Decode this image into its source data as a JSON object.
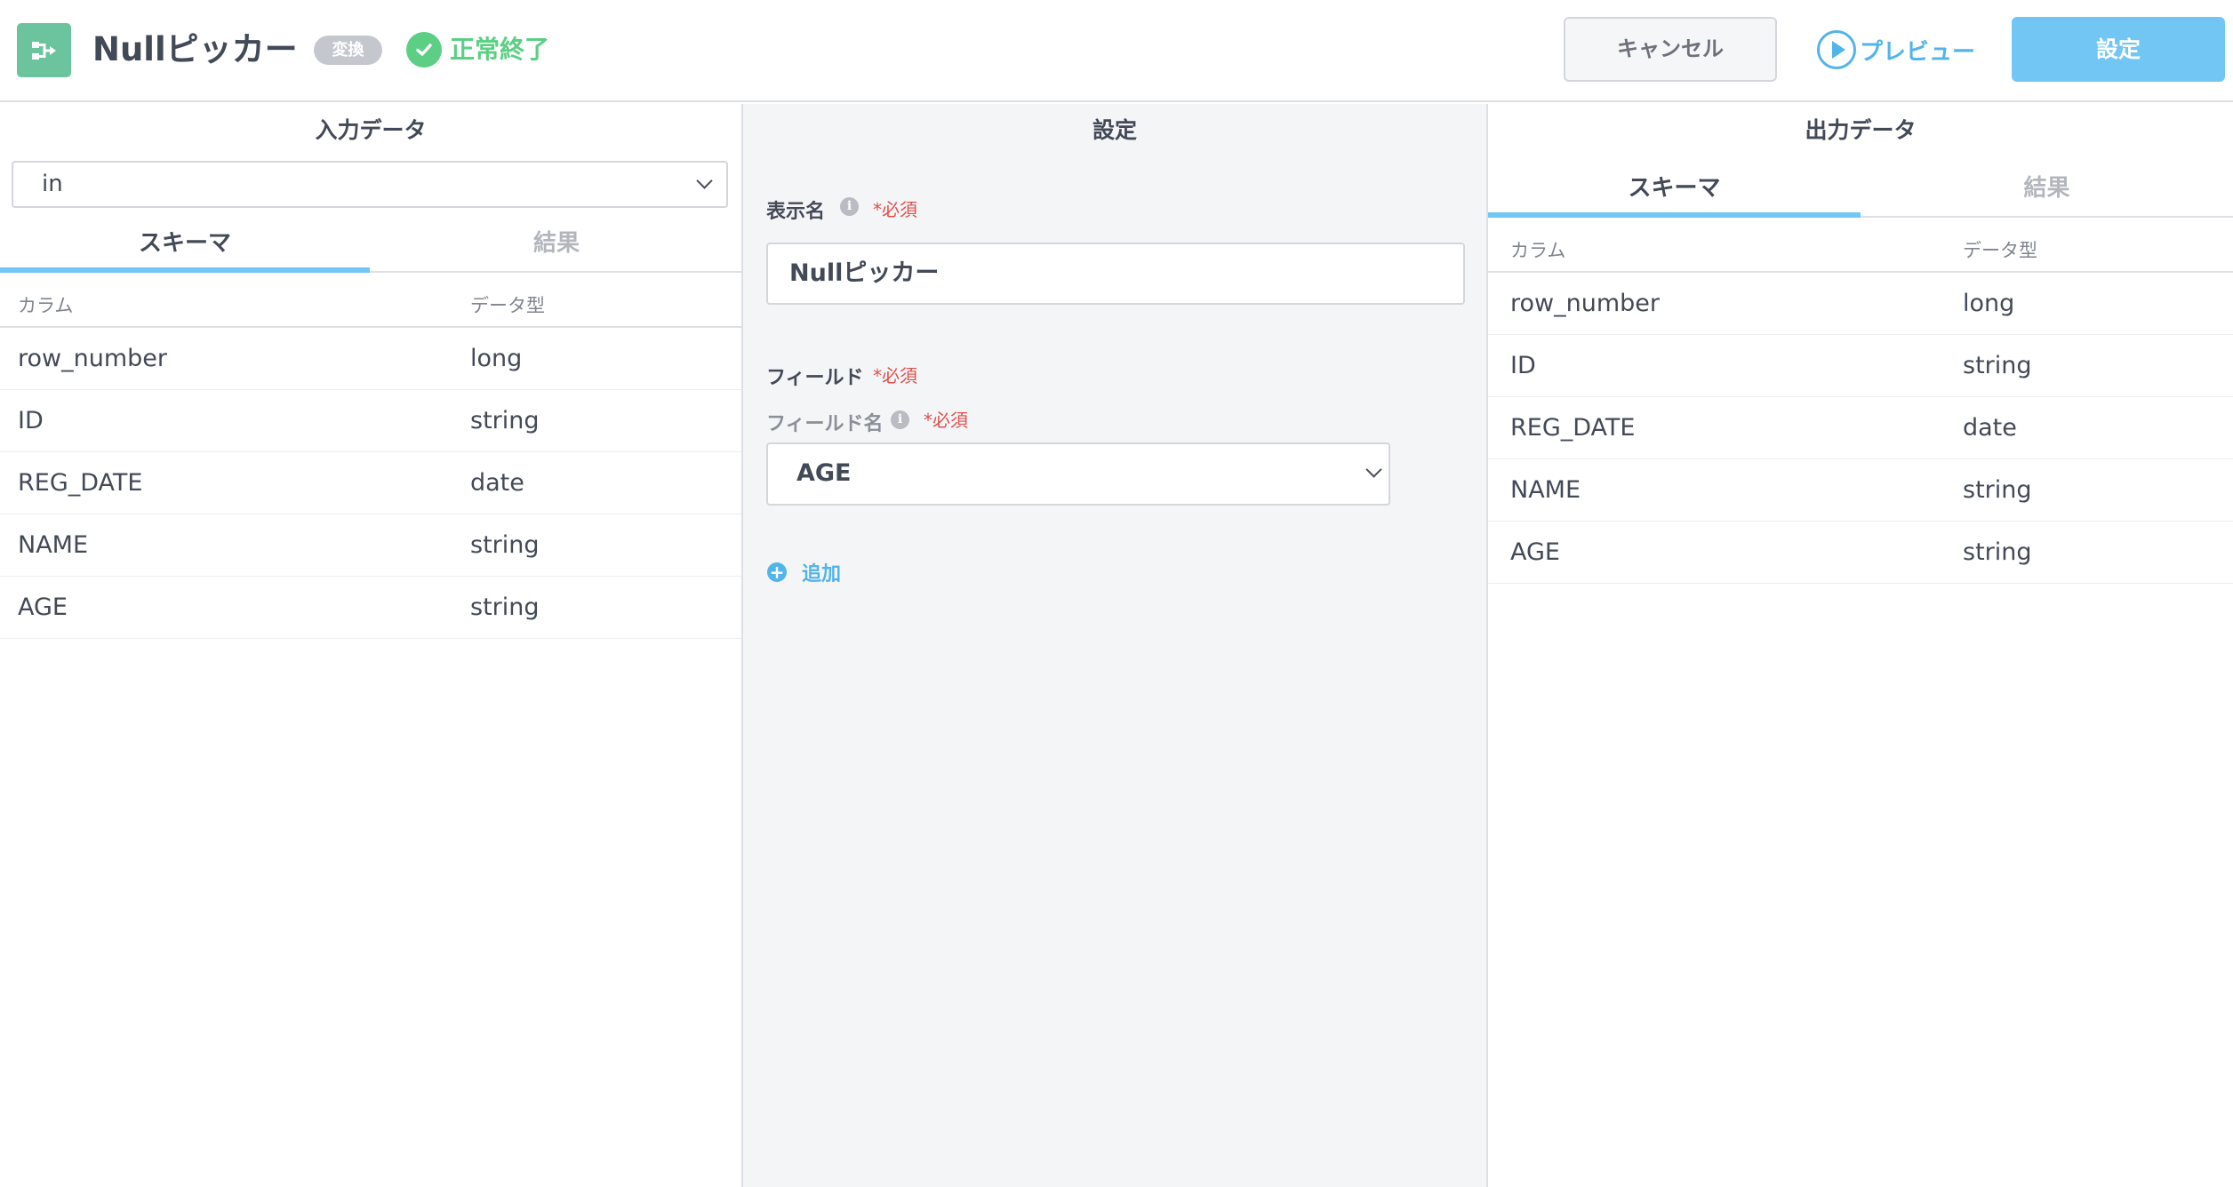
{
  "header": {
    "title": "Nullピッカー",
    "badge": "変換",
    "status": "正常終了",
    "cancel_label": "キャンセル",
    "preview_label": "プレビュー",
    "set_label": "設定"
  },
  "input_panel": {
    "title": "入力データ",
    "source_select": "in",
    "tabs": [
      "スキーマ",
      "結果"
    ],
    "active_tab": "スキーマ",
    "columns": [
      "カラム",
      "データ型"
    ],
    "rows": [
      {
        "column": "row_number",
        "type": "long"
      },
      {
        "column": "ID",
        "type": "string"
      },
      {
        "column": "REG_DATE",
        "type": "date"
      },
      {
        "column": "NAME",
        "type": "string"
      },
      {
        "column": "AGE",
        "type": "string"
      }
    ]
  },
  "settings_panel": {
    "title": "設定",
    "display_name_label": "表示名",
    "required": "*必須",
    "display_name_value": "Nullピッカー",
    "field_label": "フィールド",
    "field_name_label": "フィールド名",
    "field_name_value": "AGE",
    "add_label": "追加",
    "info_glyph": "i",
    "add_glyph": "+"
  },
  "output_panel": {
    "title": "出力データ",
    "tabs": [
      "スキーマ",
      "結果"
    ],
    "active_tab": "スキーマ",
    "columns": [
      "カラム",
      "データ型"
    ],
    "rows": [
      {
        "column": "row_number",
        "type": "long"
      },
      {
        "column": "ID",
        "type": "string"
      },
      {
        "column": "REG_DATE",
        "type": "date"
      },
      {
        "column": "NAME",
        "type": "string"
      },
      {
        "column": "AGE",
        "type": "string"
      }
    ]
  },
  "icons": {
    "node": "transform-node-icon",
    "status": "check-circle-icon",
    "preview": "play-circle-icon",
    "dropdown": "chevron-down-icon",
    "info": "info-icon",
    "add": "plus-circle-icon"
  },
  "colors": {
    "node_icon": "#6cc49e",
    "success": "#5ccf85",
    "accent": "#52b4ea",
    "primary_button": "#72c6f3",
    "required": "#e0504d"
  }
}
